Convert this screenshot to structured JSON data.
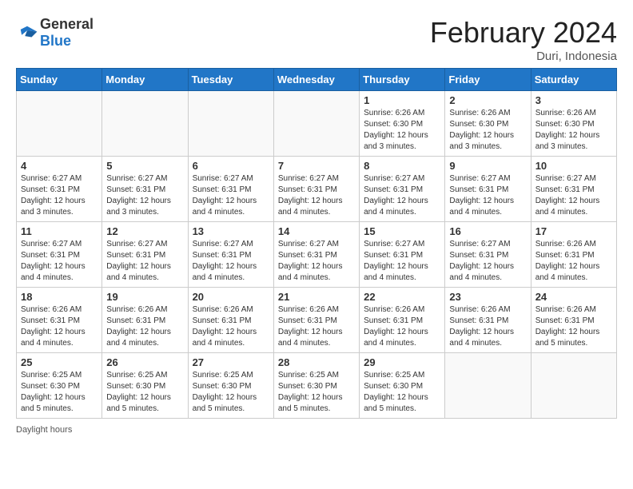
{
  "header": {
    "logo_general": "General",
    "logo_blue": "Blue",
    "title": "February 2024",
    "location": "Duri, Indonesia"
  },
  "footer": {
    "daylight_label": "Daylight hours"
  },
  "days_of_week": [
    "Sunday",
    "Monday",
    "Tuesday",
    "Wednesday",
    "Thursday",
    "Friday",
    "Saturday"
  ],
  "weeks": [
    [
      {
        "day": "",
        "info": ""
      },
      {
        "day": "",
        "info": ""
      },
      {
        "day": "",
        "info": ""
      },
      {
        "day": "",
        "info": ""
      },
      {
        "day": "1",
        "info": "Sunrise: 6:26 AM\nSunset: 6:30 PM\nDaylight: 12 hours\nand 3 minutes."
      },
      {
        "day": "2",
        "info": "Sunrise: 6:26 AM\nSunset: 6:30 PM\nDaylight: 12 hours\nand 3 minutes."
      },
      {
        "day": "3",
        "info": "Sunrise: 6:26 AM\nSunset: 6:30 PM\nDaylight: 12 hours\nand 3 minutes."
      }
    ],
    [
      {
        "day": "4",
        "info": "Sunrise: 6:27 AM\nSunset: 6:31 PM\nDaylight: 12 hours\nand 3 minutes."
      },
      {
        "day": "5",
        "info": "Sunrise: 6:27 AM\nSunset: 6:31 PM\nDaylight: 12 hours\nand 3 minutes."
      },
      {
        "day": "6",
        "info": "Sunrise: 6:27 AM\nSunset: 6:31 PM\nDaylight: 12 hours\nand 4 minutes."
      },
      {
        "day": "7",
        "info": "Sunrise: 6:27 AM\nSunset: 6:31 PM\nDaylight: 12 hours\nand 4 minutes."
      },
      {
        "day": "8",
        "info": "Sunrise: 6:27 AM\nSunset: 6:31 PM\nDaylight: 12 hours\nand 4 minutes."
      },
      {
        "day": "9",
        "info": "Sunrise: 6:27 AM\nSunset: 6:31 PM\nDaylight: 12 hours\nand 4 minutes."
      },
      {
        "day": "10",
        "info": "Sunrise: 6:27 AM\nSunset: 6:31 PM\nDaylight: 12 hours\nand 4 minutes."
      }
    ],
    [
      {
        "day": "11",
        "info": "Sunrise: 6:27 AM\nSunset: 6:31 PM\nDaylight: 12 hours\nand 4 minutes."
      },
      {
        "day": "12",
        "info": "Sunrise: 6:27 AM\nSunset: 6:31 PM\nDaylight: 12 hours\nand 4 minutes."
      },
      {
        "day": "13",
        "info": "Sunrise: 6:27 AM\nSunset: 6:31 PM\nDaylight: 12 hours\nand 4 minutes."
      },
      {
        "day": "14",
        "info": "Sunrise: 6:27 AM\nSunset: 6:31 PM\nDaylight: 12 hours\nand 4 minutes."
      },
      {
        "day": "15",
        "info": "Sunrise: 6:27 AM\nSunset: 6:31 PM\nDaylight: 12 hours\nand 4 minutes."
      },
      {
        "day": "16",
        "info": "Sunrise: 6:27 AM\nSunset: 6:31 PM\nDaylight: 12 hours\nand 4 minutes."
      },
      {
        "day": "17",
        "info": "Sunrise: 6:26 AM\nSunset: 6:31 PM\nDaylight: 12 hours\nand 4 minutes."
      }
    ],
    [
      {
        "day": "18",
        "info": "Sunrise: 6:26 AM\nSunset: 6:31 PM\nDaylight: 12 hours\nand 4 minutes."
      },
      {
        "day": "19",
        "info": "Sunrise: 6:26 AM\nSunset: 6:31 PM\nDaylight: 12 hours\nand 4 minutes."
      },
      {
        "day": "20",
        "info": "Sunrise: 6:26 AM\nSunset: 6:31 PM\nDaylight: 12 hours\nand 4 minutes."
      },
      {
        "day": "21",
        "info": "Sunrise: 6:26 AM\nSunset: 6:31 PM\nDaylight: 12 hours\nand 4 minutes."
      },
      {
        "day": "22",
        "info": "Sunrise: 6:26 AM\nSunset: 6:31 PM\nDaylight: 12 hours\nand 4 minutes."
      },
      {
        "day": "23",
        "info": "Sunrise: 6:26 AM\nSunset: 6:31 PM\nDaylight: 12 hours\nand 4 minutes."
      },
      {
        "day": "24",
        "info": "Sunrise: 6:26 AM\nSunset: 6:31 PM\nDaylight: 12 hours\nand 5 minutes."
      }
    ],
    [
      {
        "day": "25",
        "info": "Sunrise: 6:25 AM\nSunset: 6:30 PM\nDaylight: 12 hours\nand 5 minutes."
      },
      {
        "day": "26",
        "info": "Sunrise: 6:25 AM\nSunset: 6:30 PM\nDaylight: 12 hours\nand 5 minutes."
      },
      {
        "day": "27",
        "info": "Sunrise: 6:25 AM\nSunset: 6:30 PM\nDaylight: 12 hours\nand 5 minutes."
      },
      {
        "day": "28",
        "info": "Sunrise: 6:25 AM\nSunset: 6:30 PM\nDaylight: 12 hours\nand 5 minutes."
      },
      {
        "day": "29",
        "info": "Sunrise: 6:25 AM\nSunset: 6:30 PM\nDaylight: 12 hours\nand 5 minutes."
      },
      {
        "day": "",
        "info": ""
      },
      {
        "day": "",
        "info": ""
      }
    ]
  ]
}
